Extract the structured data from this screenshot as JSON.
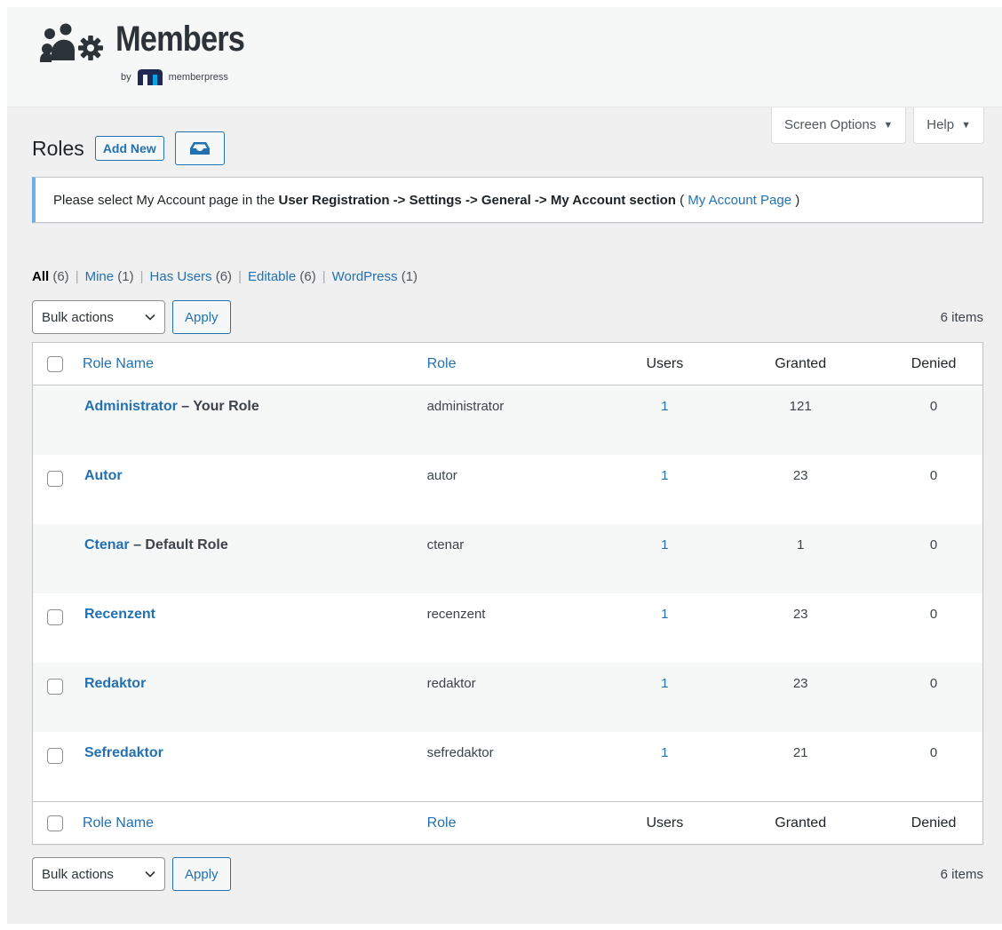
{
  "brand": {
    "name": "Members",
    "by": "by",
    "sub_brand": "memberpress",
    "logo_icon": "members-group-gear-icon"
  },
  "screen_options": {
    "label": "Screen Options",
    "arrow": "▼"
  },
  "help": {
    "label": "Help",
    "arrow": "▼"
  },
  "heading": {
    "title": "Roles",
    "add_new": "Add New",
    "inbox_icon": "inbox-icon"
  },
  "notice": {
    "text_before": "Please select My Account page in the ",
    "bold": "User Registration -> Settings -> General -> My Account section",
    "paren_open": " ( ",
    "link": "My Account Page",
    "paren_close": " )"
  },
  "views": [
    {
      "label": "All",
      "count": "(6)",
      "current": true
    },
    {
      "label": "Mine",
      "count": "(1)",
      "current": false
    },
    {
      "label": "Has Users",
      "count": "(6)",
      "current": false
    },
    {
      "label": "Editable",
      "count": "(6)",
      "current": false
    },
    {
      "label": "WordPress",
      "count": "(1)",
      "current": false
    }
  ],
  "tablenav": {
    "bulk_actions": "Bulk actions",
    "apply": "Apply",
    "items": "6 items"
  },
  "columns": {
    "role_name": "Role Name",
    "role": "Role",
    "users": "Users",
    "granted": "Granted",
    "denied": "Denied"
  },
  "rows": [
    {
      "name": "Administrator",
      "suffix": " – Your Role",
      "role": "administrator",
      "users": "1",
      "granted": "121",
      "denied": "0",
      "checkbox": false
    },
    {
      "name": "Autor",
      "suffix": "",
      "role": "autor",
      "users": "1",
      "granted": "23",
      "denied": "0",
      "checkbox": true
    },
    {
      "name": "Ctenar",
      "suffix": " – Default Role",
      "role": "ctenar",
      "users": "1",
      "granted": "1",
      "denied": "0",
      "checkbox": false
    },
    {
      "name": "Recenzent",
      "suffix": "",
      "role": "recenzent",
      "users": "1",
      "granted": "23",
      "denied": "0",
      "checkbox": true
    },
    {
      "name": "Redaktor",
      "suffix": "",
      "role": "redaktor",
      "users": "1",
      "granted": "23",
      "denied": "0",
      "checkbox": true
    },
    {
      "name": "Sefredaktor",
      "suffix": "",
      "role": "sefredaktor",
      "users": "1",
      "granted": "21",
      "denied": "0",
      "checkbox": true
    }
  ],
  "colors": {
    "link": "#2271b1",
    "notice_border": "#72aee6",
    "alt_row": "#f6f7f7"
  }
}
